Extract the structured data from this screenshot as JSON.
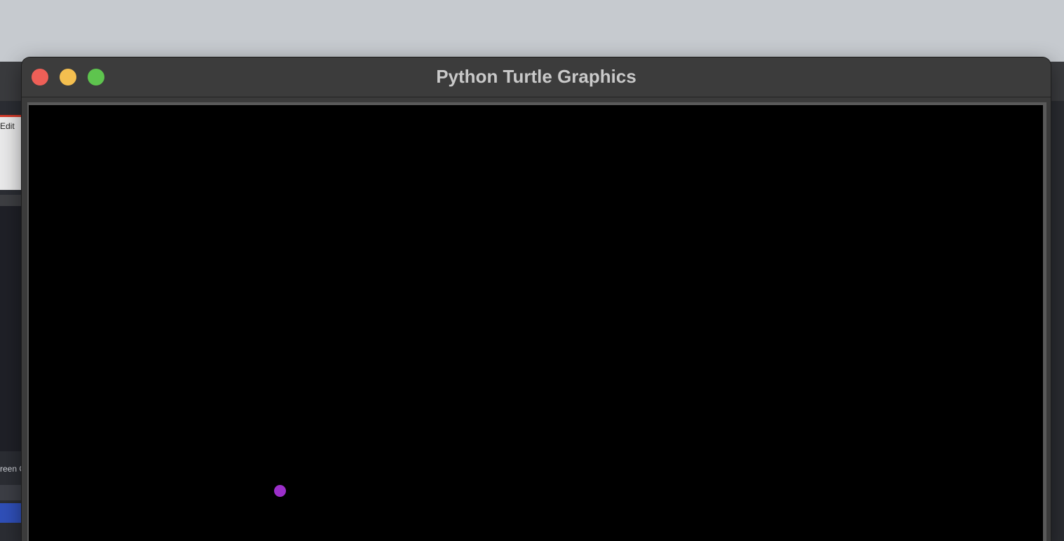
{
  "window": {
    "title": "Python Turtle Graphics"
  },
  "background_app": {
    "menu_label": "Edit",
    "tool_label": "reen C"
  },
  "canvas": {
    "background_color": "#000000",
    "dot_color": "#9b2fc9"
  },
  "icons": {
    "close": "close-icon",
    "minimize": "minimize-icon",
    "zoom": "zoom-icon"
  }
}
